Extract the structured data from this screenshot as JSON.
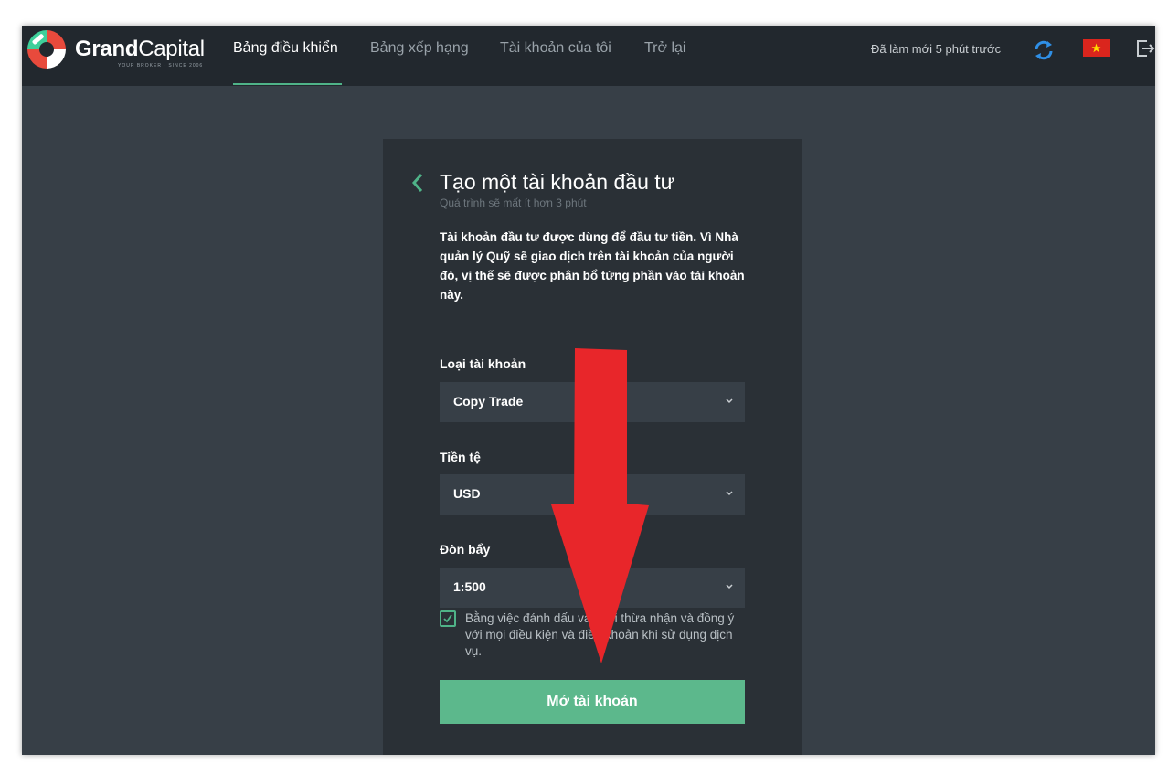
{
  "brand": {
    "name_bold": "Grand",
    "name_regular": "Capital",
    "tagline": "YOUR BROKER · SINCE 2006"
  },
  "nav": {
    "items": [
      {
        "label": "Bảng điều khiển",
        "active": true
      },
      {
        "label": "Bảng xếp hạng",
        "active": false
      },
      {
        "label": "Tài khoản của tôi",
        "active": false
      },
      {
        "label": "Trở lại",
        "active": false
      }
    ]
  },
  "header": {
    "refresh_text": "Đã làm mới 5 phút trước"
  },
  "form": {
    "title": "Tạo một tài khoản đầu tư",
    "subtitle": "Quá trình sẽ mất ít hơn 3 phút",
    "description": "Tài khoản đầu tư được dùng để đầu tư tiền. Vì Nhà quản lý Quỹ sẽ giao dịch trên tài khoản của người đó, vị thế sẽ được phân bổ từng phần vào tài khoản này.",
    "account_type": {
      "label": "Loại tài khoản",
      "value": "Copy Trade"
    },
    "currency": {
      "label": "Tiền tệ",
      "value": "USD"
    },
    "leverage": {
      "label": "Đòn bẩy",
      "value": "1:500"
    },
    "terms": {
      "checked": true,
      "text": "Bằng việc đánh dấu vào, tôi thừa nhận và đồng ý với mọi điều kiện và điều khoản khi sử dụng dịch vụ."
    },
    "submit_label": "Mở tài khoản"
  },
  "colors": {
    "accent": "#5cb88c",
    "header_bg": "#22282e",
    "page_bg": "#373f47",
    "card_bg": "#2a3036",
    "arrow": "#e8262a"
  }
}
